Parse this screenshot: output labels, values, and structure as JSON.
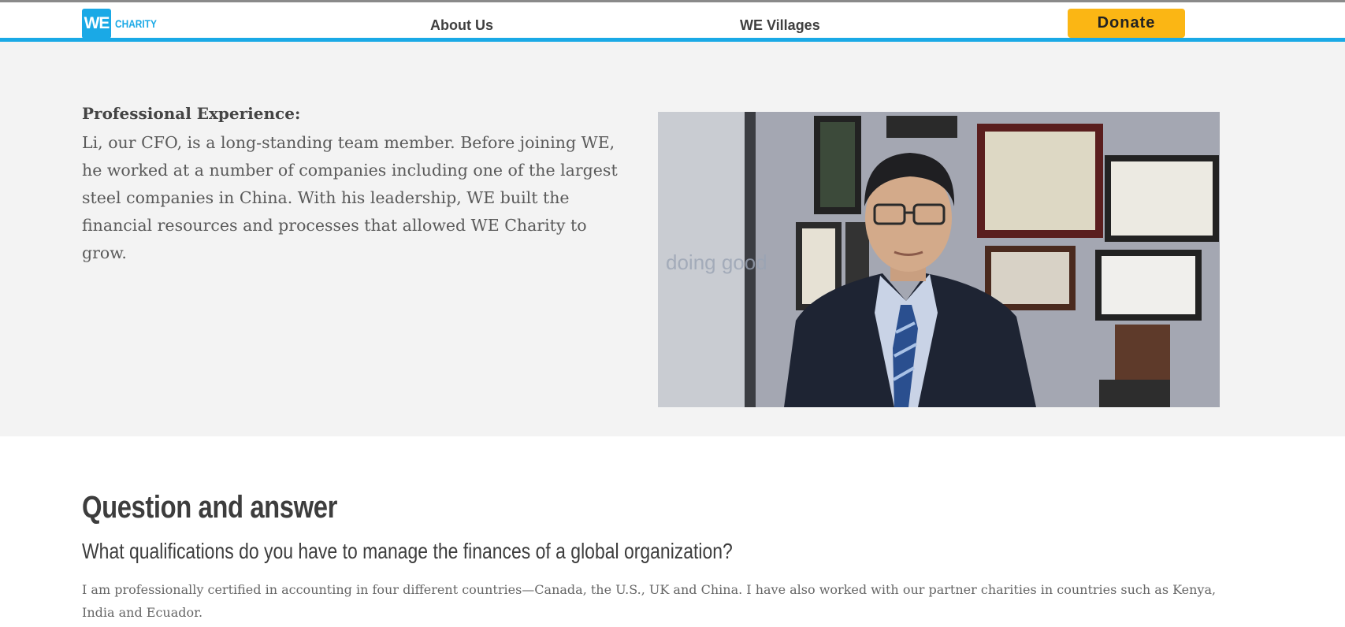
{
  "header": {
    "logo_mark": "WE",
    "logo_text": "CHARITY",
    "nav": [
      {
        "label": "About Us"
      },
      {
        "label": "WE Villages"
      }
    ],
    "donate_label": "Donate"
  },
  "profile": {
    "section_title": "Professional Experience:",
    "body": "Li, our CFO, is a long-standing team member. Before joining WE, he worked at a number of companies including one of the largest steel companies in China. With his leadership, WE built the financial resources and processes that allowed WE Charity to grow.",
    "photo_wall_text": "doing good"
  },
  "qa": {
    "heading": "Question and answer",
    "question": "What qualifications do you have to manage the finances of a global organization?",
    "answer": "I am professionally certified in accounting in four different countries—Canada, the U.S., UK and China. I have also worked with our partner charities in countries such as Kenya, India and Ecuador."
  },
  "colors": {
    "brand_blue": "#1aa9e6",
    "donate_yellow": "#fbb614",
    "section_gray": "#f3f3f3"
  }
}
